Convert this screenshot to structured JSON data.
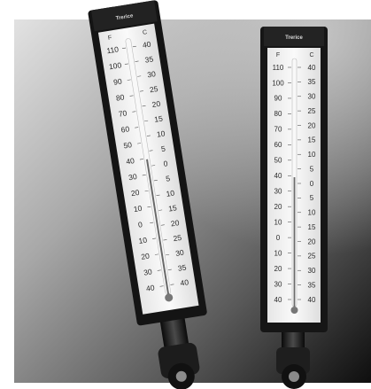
{
  "photo": {
    "subject": "two industrial glass-tube thermometers in black cases",
    "colors": {
      "backdrop_light": "#bdbdbd",
      "backdrop_dark": "#151515",
      "frame": "#1a1a1a",
      "scale_panel": "#f4f4f4",
      "ink": "#202020"
    }
  },
  "left_thermometer": {
    "brand": "Trerice",
    "unit_left": "F",
    "unit_right": "C",
    "fahrenheit_ticks": [
      "110",
      "100",
      "90",
      "80",
      "70",
      "60",
      "50",
      "40",
      "30",
      "20",
      "10",
      "0",
      "10",
      "20",
      "30",
      "40"
    ],
    "celsius_ticks": [
      "40",
      "35",
      "30",
      "25",
      "20",
      "15",
      "10",
      "5",
      "0",
      "5",
      "10",
      "15",
      "20",
      "25",
      "30",
      "35",
      "40"
    ]
  },
  "right_thermometer": {
    "brand": "Trerice",
    "unit_left": "F",
    "unit_right": "C",
    "fahrenheit_ticks": [
      "110",
      "100",
      "90",
      "80",
      "70",
      "60",
      "50",
      "40",
      "30",
      "20",
      "10",
      "0",
      "10",
      "20",
      "30",
      "40"
    ],
    "celsius_ticks": [
      "40",
      "35",
      "30",
      "25",
      "20",
      "15",
      "10",
      "5",
      "0",
      "5",
      "10",
      "15",
      "20",
      "25",
      "30",
      "35",
      "40"
    ]
  }
}
